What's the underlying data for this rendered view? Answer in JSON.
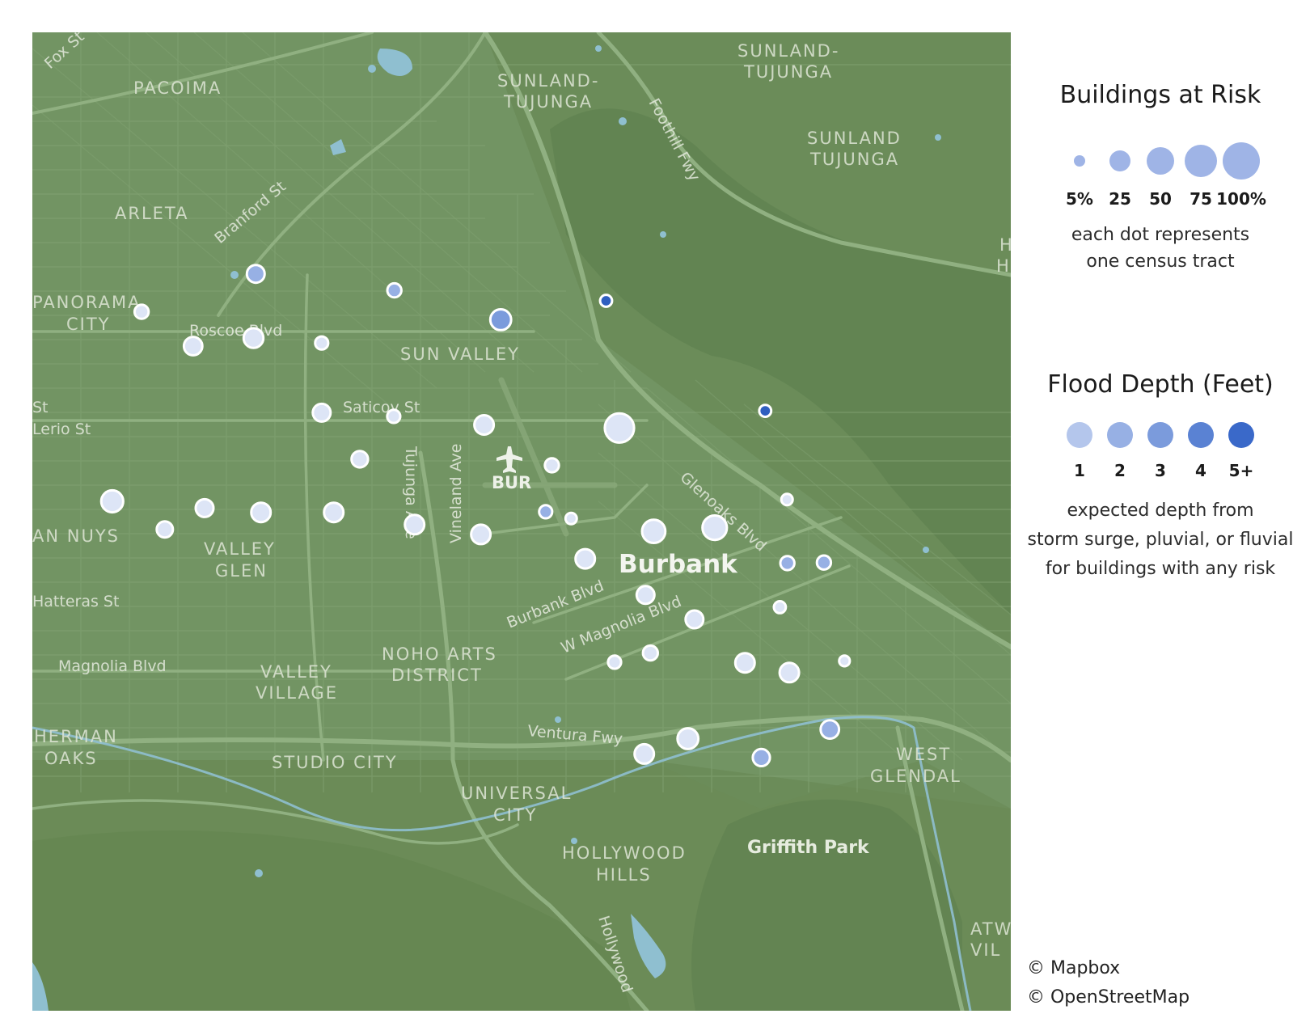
{
  "map": {
    "place_labels": [
      "PACOIMA",
      "SUNLAND-",
      "TUJUNGA",
      "SUNLAND-",
      "TUJUNGA",
      "SUNLAND",
      "TUJUNGA",
      "ARLETA",
      "PANORAMA",
      "CITY",
      "SUN VALLEY",
      "AN NUYS",
      "VALLEY",
      "GLEN",
      "NOHO ARTS",
      "DISTRICT",
      "VALLEY",
      "VILLAGE",
      "HERMAN",
      "OAKS",
      "STUDIO CITY",
      "UNIVERSAL",
      "CITY",
      "HOLLYWOOD",
      "HILLS",
      "WEST",
      "GLENDAL",
      "ATW",
      "VIL",
      "H",
      "HI"
    ],
    "road_labels": [
      "Fox St",
      "Branford St",
      "Roscoe Blvd",
      "Saticoy St",
      "Tujunga Ave",
      "Vineland Ave",
      "Foothill Fwy",
      "Glenoaks Blvd",
      "Burbank Blvd",
      "W Magnolia Blvd",
      "Magnolia Blvd",
      "Ventura Fwy",
      "Hatteras St",
      "Lerio St",
      "St",
      "Hollywood"
    ],
    "city_label": "Burbank",
    "park_label": "Griffith Park",
    "airport_label": "BUR",
    "water_color": "#8fbfd0",
    "land_color": "#6a8c58",
    "dots": [
      {
        "tract": 1,
        "lon": -118.4115,
        "lat": 34.2205,
        "risk_pct": 20,
        "depth_ft": 2
      },
      {
        "tract": 2,
        "lon": -118.4465,
        "lat": 34.2143,
        "risk_pct": 10,
        "depth_ft": 1
      },
      {
        "tract": 3,
        "lon": -118.4307,
        "lat": 34.2087,
        "risk_pct": 22,
        "depth_ft": 1
      },
      {
        "tract": 4,
        "lon": -118.4122,
        "lat": 34.21,
        "risk_pct": 26,
        "depth_ft": 1
      },
      {
        "tract": 5,
        "lon": -118.3913,
        "lat": 34.2092,
        "risk_pct": 8,
        "depth_ft": 1
      },
      {
        "tract": 6,
        "lon": -118.369,
        "lat": 34.2178,
        "risk_pct": 10,
        "depth_ft": 2
      },
      {
        "tract": 7,
        "lon": -118.3364,
        "lat": 34.213,
        "risk_pct": 30,
        "depth_ft": 3
      },
      {
        "tract": 8,
        "lon": -118.3041,
        "lat": 34.2161,
        "risk_pct": 6,
        "depth_ft": 5
      },
      {
        "tract": 9,
        "lon": -118.3,
        "lat": 34.1953,
        "risk_pct": 70,
        "depth_ft": 1
      },
      {
        "tract": 10,
        "lon": -118.3913,
        "lat": 34.1978,
        "risk_pct": 20,
        "depth_ft": 1
      },
      {
        "tract": 11,
        "lon": -118.3692,
        "lat": 34.1972,
        "risk_pct": 8,
        "depth_ft": 1
      },
      {
        "tract": 12,
        "lon": -118.3415,
        "lat": 34.1958,
        "risk_pct": 25,
        "depth_ft": 1
      },
      {
        "tract": 13,
        "lon": -118.2553,
        "lat": 34.1981,
        "risk_pct": 6,
        "depth_ft": 5
      },
      {
        "tract": 14,
        "lon": -118.3796,
        "lat": 34.1902,
        "risk_pct": 16,
        "depth_ft": 1
      },
      {
        "tract": 15,
        "lon": -118.3207,
        "lat": 34.1892,
        "risk_pct": 10,
        "depth_ft": 1
      },
      {
        "tract": 16,
        "lon": -118.4555,
        "lat": 34.1833,
        "risk_pct": 35,
        "depth_ft": 1
      },
      {
        "tract": 17,
        "lon": -118.4272,
        "lat": 34.1822,
        "risk_pct": 20,
        "depth_ft": 1
      },
      {
        "tract": 18,
        "lon": -118.4099,
        "lat": 34.1815,
        "risk_pct": 25,
        "depth_ft": 1
      },
      {
        "tract": 19,
        "lon": -118.3876,
        "lat": 34.1815,
        "risk_pct": 25,
        "depth_ft": 1
      },
      {
        "tract": 20,
        "lon": -118.3628,
        "lat": 34.1795,
        "risk_pct": 25,
        "depth_ft": 1
      },
      {
        "tract": 21,
        "lon": -118.3425,
        "lat": 34.1779,
        "risk_pct": 25,
        "depth_ft": 1
      },
      {
        "tract": 22,
        "lon": -118.4394,
        "lat": 34.1787,
        "risk_pct": 15,
        "depth_ft": 1
      },
      {
        "tract": 23,
        "lon": -118.3105,
        "lat": 34.1739,
        "risk_pct": 25,
        "depth_ft": 1
      },
      {
        "tract": 24,
        "lon": -118.2895,
        "lat": 34.1784,
        "risk_pct": 40,
        "depth_ft": 1
      },
      {
        "tract": 25,
        "lon": -118.3226,
        "lat": 34.1816,
        "risk_pct": 8,
        "depth_ft": 2
      },
      {
        "tract": 26,
        "lon": -118.3148,
        "lat": 34.1805,
        "risk_pct": 5,
        "depth_ft": 1
      },
      {
        "tract": 27,
        "lon": -118.2486,
        "lat": 34.1836,
        "risk_pct": 5,
        "depth_ft": 1
      },
      {
        "tract": 28,
        "lon": -118.2708,
        "lat": 34.179,
        "risk_pct": 45,
        "depth_ft": 1
      },
      {
        "tract": 29,
        "lon": -118.2485,
        "lat": 34.1732,
        "risk_pct": 10,
        "depth_ft": 2
      },
      {
        "tract": 30,
        "lon": -118.2373,
        "lat": 34.1733,
        "risk_pct": 10,
        "depth_ft": 2
      },
      {
        "tract": 31,
        "lon": -118.292,
        "lat": 34.168,
        "risk_pct": 20,
        "depth_ft": 1
      },
      {
        "tract": 32,
        "lon": -118.277,
        "lat": 34.164,
        "risk_pct": 20,
        "depth_ft": 1
      },
      {
        "tract": 33,
        "lon": -118.2508,
        "lat": 34.166,
        "risk_pct": 6,
        "depth_ft": 1
      },
      {
        "tract": 34,
        "lon": -118.2905,
        "lat": 34.1585,
        "risk_pct": 12,
        "depth_ft": 1
      },
      {
        "tract": 35,
        "lon": -118.3015,
        "lat": 34.157,
        "risk_pct": 8,
        "depth_ft": 1
      },
      {
        "tract": 36,
        "lon": -118.2615,
        "lat": 34.1569,
        "risk_pct": 25,
        "depth_ft": 1
      },
      {
        "tract": 37,
        "lon": -118.2479,
        "lat": 34.1553,
        "risk_pct": 25,
        "depth_ft": 1
      },
      {
        "tract": 38,
        "lon": -118.231,
        "lat": 34.1572,
        "risk_pct": 4,
        "depth_ft": 1
      },
      {
        "tract": 39,
        "lon": -118.2355,
        "lat": 34.146,
        "risk_pct": 22,
        "depth_ft": 2
      },
      {
        "tract": 40,
        "lon": -118.279,
        "lat": 34.1445,
        "risk_pct": 30,
        "depth_ft": 1
      },
      {
        "tract": 41,
        "lon": -118.2924,
        "lat": 34.142,
        "risk_pct": 25,
        "depth_ft": 1
      },
      {
        "tract": 42,
        "lon": -118.2565,
        "lat": 34.1414,
        "risk_pct": 18,
        "depth_ft": 2
      }
    ]
  },
  "legend": {
    "size_title": "Buildings at Risk",
    "size_items": [
      {
        "label": "5%",
        "value": 5
      },
      {
        "label": "25",
        "value": 25
      },
      {
        "label": "50",
        "value": 50
      },
      {
        "label": "75",
        "value": 75
      },
      {
        "label": "100%",
        "value": 100
      }
    ],
    "size_note_line1": "each dot represents",
    "size_note_line2": "one census tract",
    "depth_title": "Flood Depth (Feet)",
    "depth_items": [
      {
        "label": "1",
        "color": "#b4c6ec"
      },
      {
        "label": "2",
        "color": "#97b0e4"
      },
      {
        "label": "3",
        "color": "#7b9bdc"
      },
      {
        "label": "4",
        "color": "#5a82d3"
      },
      {
        "label": "5+",
        "color": "#3a69c9"
      }
    ],
    "depth_note_line1": "expected depth from",
    "depth_note_line2": "storm surge, pluvial, or fluvial",
    "depth_note_line3": "for buildings with any risk"
  },
  "credits": {
    "line1": "© Mapbox",
    "line2": "© OpenStreetMap"
  }
}
